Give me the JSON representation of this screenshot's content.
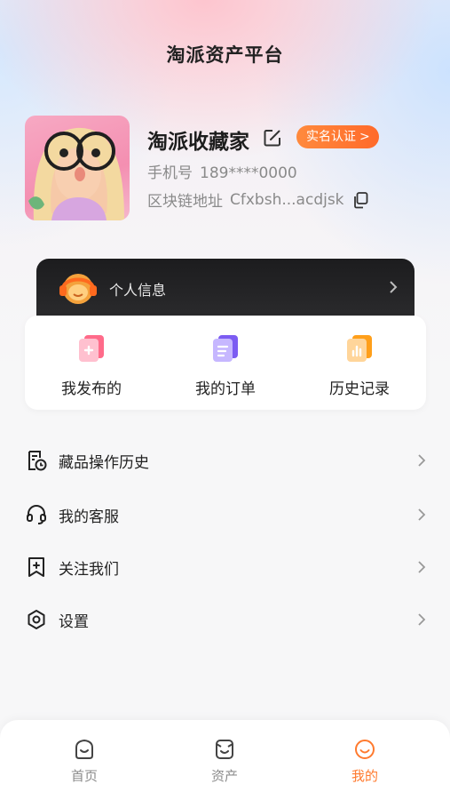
{
  "header": {
    "title": "淘派资产平台"
  },
  "profile": {
    "name": "淘派收藏家",
    "verify_label": "实名认证",
    "verify_chevron": ">",
    "phone_label": "手机号",
    "phone_value": "189****0000",
    "chain_label": "区块链地址",
    "chain_value": "Cfxbsh...acdjsk"
  },
  "info_card": {
    "label": "个人信息"
  },
  "quick_actions": [
    {
      "label": "我发布的",
      "icon": "published-icon"
    },
    {
      "label": "我的订单",
      "icon": "orders-icon"
    },
    {
      "label": "历史记录",
      "icon": "history-icon"
    }
  ],
  "menu": [
    {
      "label": "藏品操作历史",
      "icon": "collection-history-icon"
    },
    {
      "label": "我的客服",
      "icon": "headset-icon"
    },
    {
      "label": "关注我们",
      "icon": "follow-icon"
    },
    {
      "label": "设置",
      "icon": "settings-icon"
    }
  ],
  "tabbar": [
    {
      "label": "首页",
      "icon": "home-icon",
      "active": false
    },
    {
      "label": "资产",
      "icon": "assets-icon",
      "active": false
    },
    {
      "label": "我的",
      "icon": "me-icon",
      "active": true
    }
  ],
  "colors": {
    "accent": "#ff7a2e",
    "dark_card": "#1c1c1e",
    "text_secondary": "#8a8a8a"
  }
}
